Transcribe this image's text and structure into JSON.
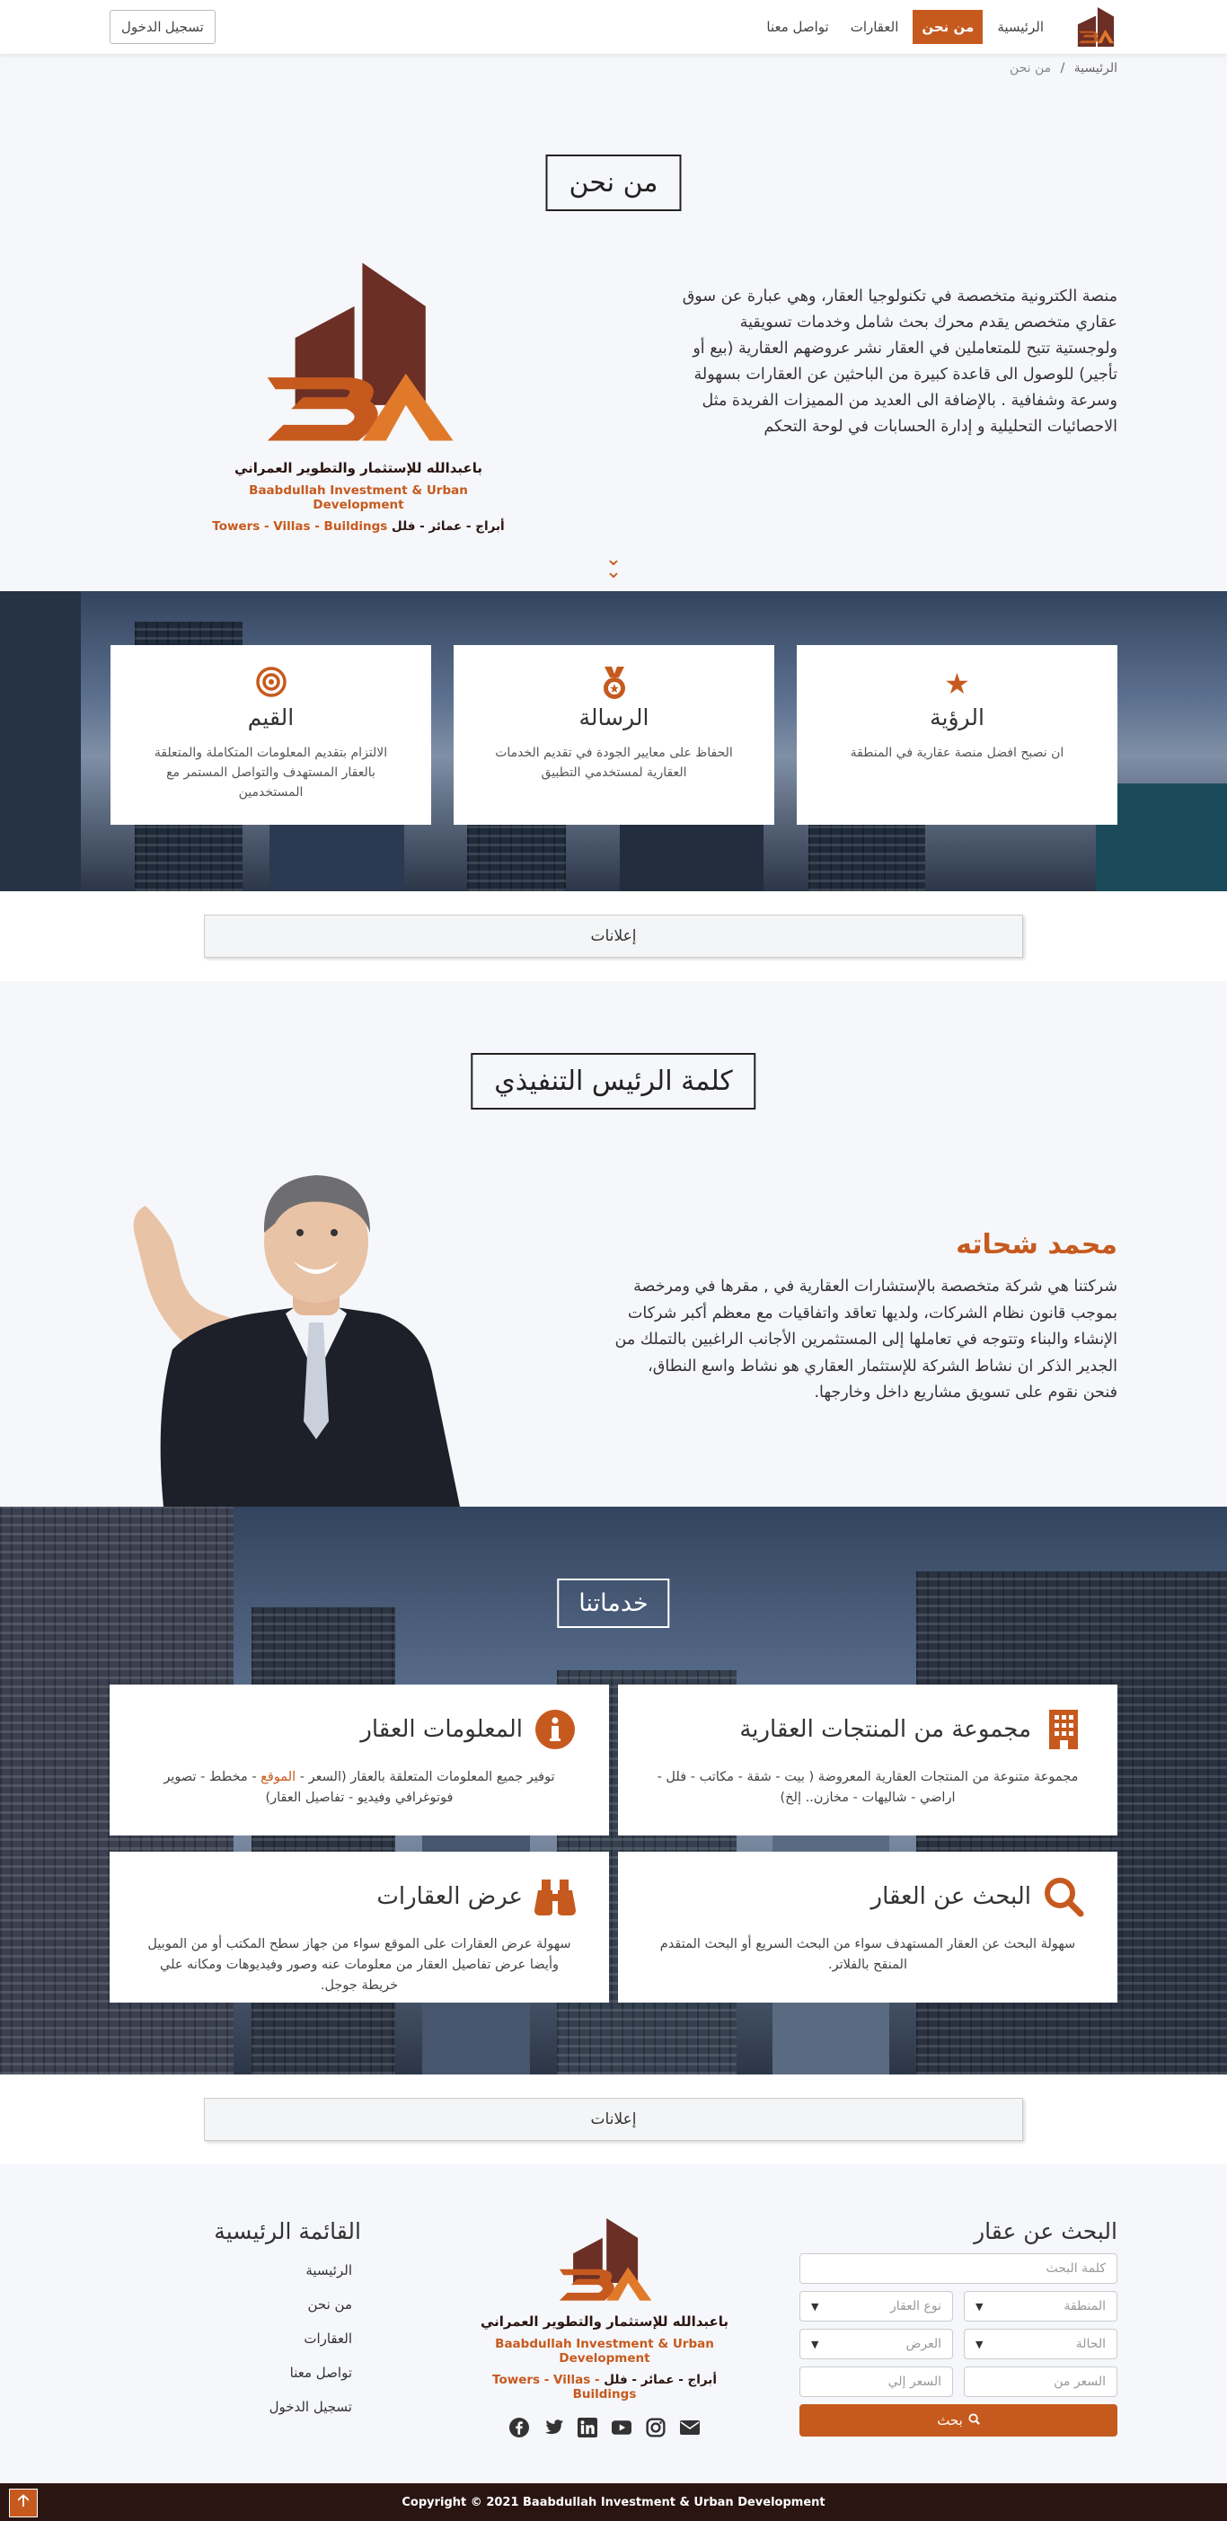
{
  "nav": {
    "items": [
      {
        "label": "الرئيسية"
      },
      {
        "label": "من نحن"
      },
      {
        "label": "العقارات"
      },
      {
        "label": "تواصل معنا"
      }
    ],
    "login": "تسجيل الدخول"
  },
  "breadcrumb": {
    "home": "الرئيسية",
    "sep": "/",
    "current": "من نحن"
  },
  "about": {
    "title": "من نحن",
    "text": "منصة الكترونية متخصصة في تكنولوجيا العقار، وهي عبارة عن سوق عقاري متخصص يقدم محرك بحث شامل وخدمات تسويقية ولوجستية تتيح للمتعاملين في العقار نشر عروضهم العقارية (بيع أو تأجير) للوصول الى قاعدة كبيرة من الباحثين عن العقارات بسهولة وسرعة وشفافية . بالإضافة الى العديد من المميزات الفريدة مثل الاحصائيات التحليلية و إدارة الحسابات في لوحة التحكم"
  },
  "brand": {
    "name_ar": "باعبدالله للإستثمار والتطوير العمراني",
    "name_en": "Baabdullah Investment & Urban Development",
    "tagline_en": "Towers - Villas - Buildings",
    "tagline_ar": "أبراج - عمائر - فلل",
    "colors": {
      "primary": "#c65a1e",
      "dark": "#2a1512",
      "roof": "#6b2f26"
    }
  },
  "values": [
    {
      "icon": "star-icon",
      "title": "الرؤية",
      "text": "ان نصبح افضل منصة عقارية في المنطقة"
    },
    {
      "icon": "medal-icon",
      "title": "الرسالة",
      "text": "الحفاظ على معايير الجودة في تقديم الخدمات العقارية لمستخدمي التطبيق"
    },
    {
      "icon": "target-icon",
      "title": "القيم",
      "text": "الالتزام بتقديم المعلومات المتكاملة والمتعلقة بالعقار المستهدف والتواصل المستمر مع المستخدمين"
    }
  ],
  "ads": {
    "label": "إعلانات"
  },
  "ceo": {
    "title": "كلمة الرئيس التنفيذي",
    "name": "محمد شحاته",
    "text": "شركتنا هي شركة متخصصة بالإستشارات العقارية في , مقرها في ومرخصة بموجب قانون نظام الشركات، ولديها تعاقد واتفاقيات مع معظم أكبر شركات الإنشاء والبناء وتتوجه في تعاملها إلى المستثمرين الأجانب الراغبين بالتملك من الجدير الذكر ان نشاط الشركة للإستثمار العقاري هو نشاط واسع النطاق، فنحن نقوم على تسويق مشاريع داخل وخارجها."
  },
  "services": {
    "title": "خدماتنا",
    "items": [
      {
        "icon": "building-icon",
        "title": "مجموعة من المنتجات العقارية",
        "text": "مجموعة متنوعة من المنتجات العقارية المعروضة ( بيت - شقة - مكاتب - فلل - اراضي - شاليهات - مخازن.. إلخ)"
      },
      {
        "icon": "info-icon",
        "title": "المعلومات العقار",
        "text_a": "توفير جميع المعلومات المتعلقة بالعقار (السعر - ",
        "text_hl": "الموقع",
        "text_b": " - مخطط - تصوير فوتوغرافي وفيديو - تفاصيل العقار)"
      },
      {
        "icon": "search-icon",
        "title": "البحث عن العقار",
        "text": "سهولة البحث عن العقار المستهدف سواء من البحث السريع أو البحث المتقدم المنقح بالفلاتر."
      },
      {
        "icon": "binoculars-icon",
        "title": "عرض العقارات",
        "text": "سهولة عرض العقارات على الموقع سواء من جهاز سطح المكتب أو من الموبيل وأيضا عرض تفاصيل العقار من معلومات عنه وصور وفيديوهات ومكانه علي خريطة جوجل."
      }
    ]
  },
  "footer": {
    "search": {
      "title": "البحث عن عقار",
      "keyword_placeholder": "كلمة البحث",
      "region": "المنطقة",
      "type": "نوع العقار",
      "status": "الحالة",
      "offer": "العرض",
      "price_from": "السعر من",
      "price_to": "السعر إلي",
      "button": "بحث"
    },
    "menu": {
      "title": "القائمة الرئيسية",
      "links": [
        "الرئيسية",
        "من نحن",
        "العقارات",
        "تواصل معنا",
        "تسجيل الدخول"
      ]
    },
    "social": [
      "facebook-icon",
      "twitter-icon",
      "linkedin-icon",
      "youtube-icon",
      "instagram-icon",
      "mail-icon"
    ],
    "copyright": "Copyright © 2021 Baabdullah Investment & Urban Development"
  }
}
